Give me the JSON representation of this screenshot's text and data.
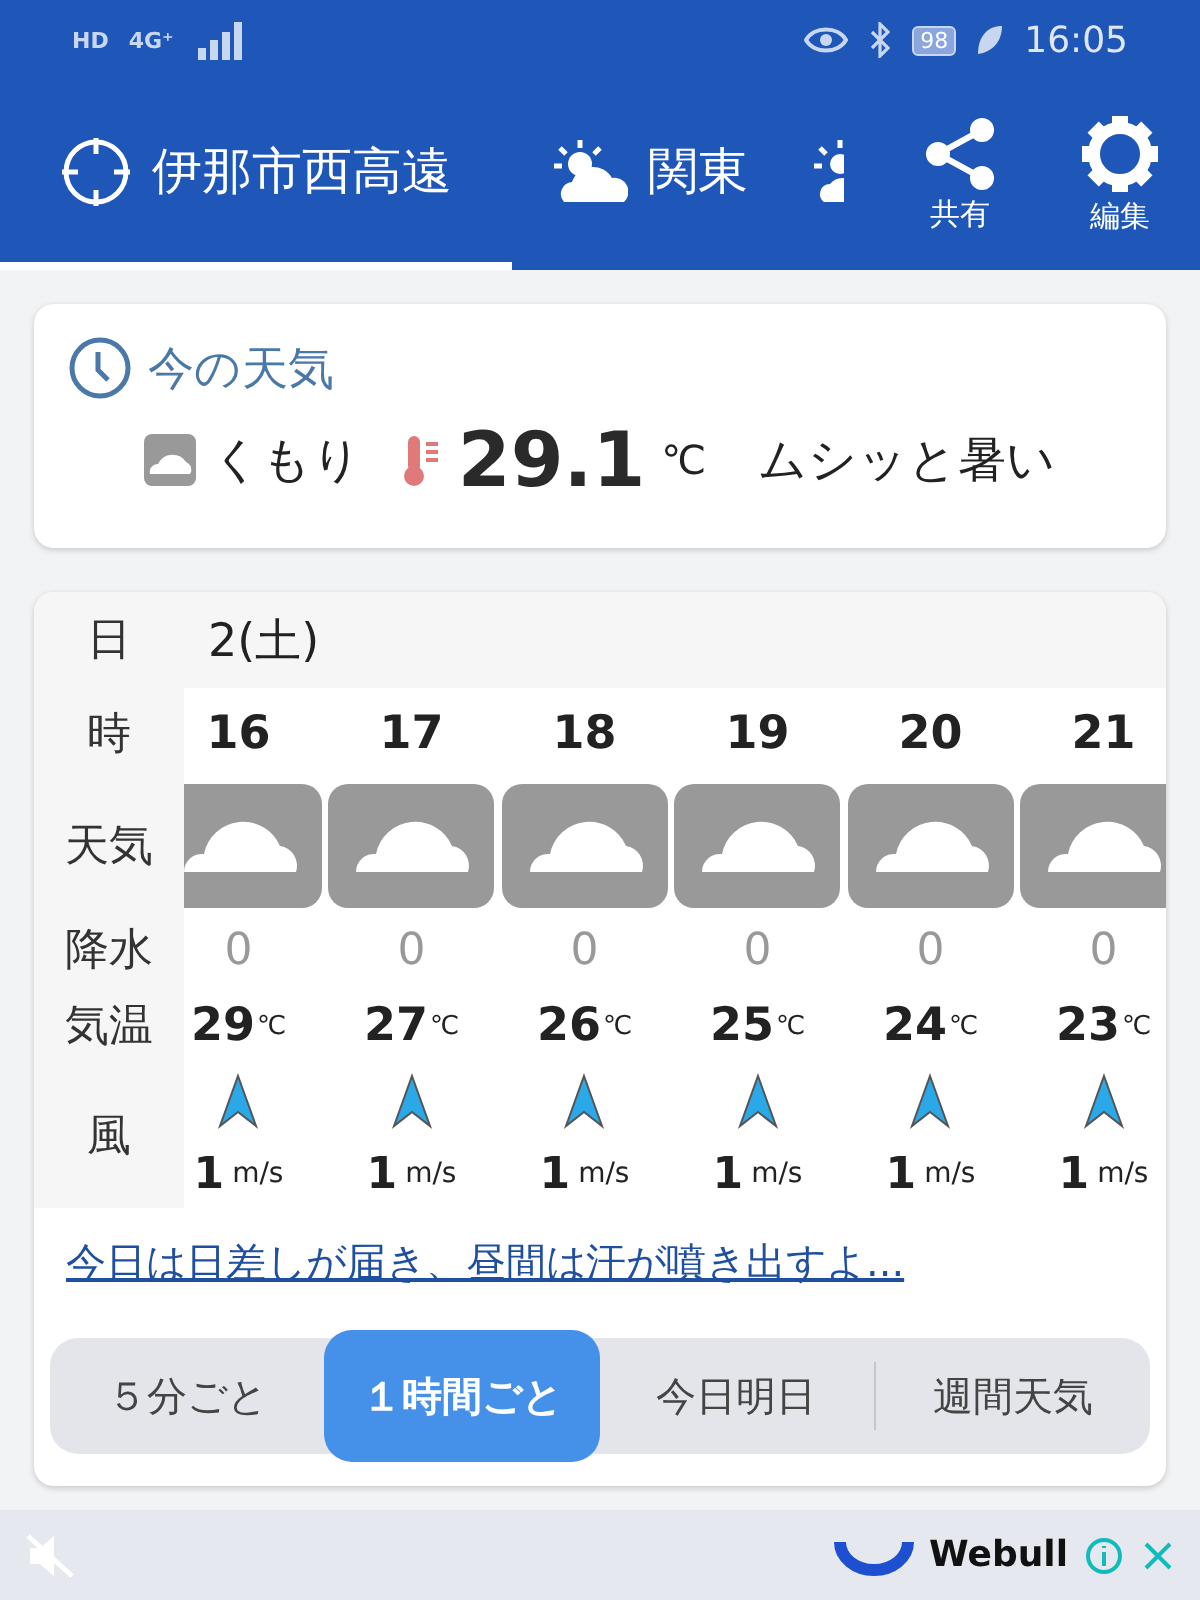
{
  "status_bar": {
    "left_badges": [
      "HD",
      "4G⁺"
    ],
    "battery": "98",
    "time": "16:05"
  },
  "tabs": [
    {
      "kind": "location",
      "label": "伊那市西高遠",
      "selected": true
    },
    {
      "kind": "region",
      "label": "関東",
      "selected": false
    },
    {
      "kind": "partial",
      "selected": false
    }
  ],
  "actions": [
    {
      "kind": "share",
      "label": "共有"
    },
    {
      "kind": "settings",
      "label": "編集"
    }
  ],
  "current": {
    "title": "今の天気",
    "condition": "くもり",
    "temperature": "29.1",
    "unit": "℃",
    "feeling": "ムシッと暑い"
  },
  "forecast": {
    "labels": {
      "date": "日",
      "hour": "時",
      "weather": "天気",
      "rain": "降水",
      "temp": "気温",
      "wind": "風"
    },
    "date": "2(土)",
    "hours": [
      {
        "hour": "16",
        "kind": "cloudy",
        "rain": "0",
        "temp": "29",
        "unit": "℃",
        "speed": "1",
        "speed_unit": "m/s"
      },
      {
        "hour": "17",
        "kind": "cloudy",
        "rain": "0",
        "temp": "27",
        "unit": "℃",
        "speed": "1",
        "speed_unit": "m/s"
      },
      {
        "hour": "18",
        "kind": "cloudy",
        "rain": "0",
        "temp": "26",
        "unit": "℃",
        "speed": "1",
        "speed_unit": "m/s"
      },
      {
        "hour": "19",
        "kind": "cloudy",
        "rain": "0",
        "temp": "25",
        "unit": "℃",
        "speed": "1",
        "speed_unit": "m/s"
      },
      {
        "hour": "20",
        "kind": "cloudy",
        "rain": "0",
        "temp": "24",
        "unit": "℃",
        "speed": "1",
        "speed_unit": "m/s"
      },
      {
        "hour": "21",
        "kind": "cloudy",
        "rain": "0",
        "temp": "23",
        "unit": "℃",
        "speed": "1",
        "speed_unit": "m/s"
      }
    ]
  },
  "summary_link": "今日は日差しが届き、昼間は汗が噴き出すよ...",
  "segments": [
    {
      "label": "５分ごと",
      "selected": false
    },
    {
      "label": "１時間ごと",
      "selected": true
    },
    {
      "label": "今日明日",
      "selected": false
    },
    {
      "label": "週間天気",
      "selected": false
    }
  ],
  "ad": {
    "brand": "Webull"
  }
}
